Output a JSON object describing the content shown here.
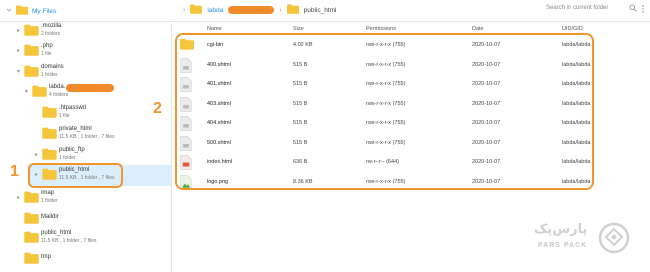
{
  "topbar": {
    "my_files": "My Files",
    "crumbs": [
      "labda",
      "public_html"
    ],
    "search_placeholder": "Search in current folder"
  },
  "sidebar": {
    "items": [
      {
        "name": ".mozilla",
        "meta": "2 folders"
      },
      {
        "name": ".php",
        "meta": "1 file"
      },
      {
        "name": "domains",
        "meta": "1 folder"
      },
      {
        "name": "labda.",
        "meta": "4 folders"
      },
      {
        "name": ".htpasswd",
        "meta": "1 file"
      },
      {
        "name": "private_html",
        "meta": "11.5 KB , 1 folder , 7 files"
      },
      {
        "name": "public_ftp",
        "meta": "1 folder"
      },
      {
        "name": "public_html",
        "meta": "11.5 KB , 1 folder , 7 files"
      },
      {
        "name": "imap",
        "meta": "1 folder"
      },
      {
        "name": "Maildir",
        "meta": ""
      },
      {
        "name": "public_html",
        "meta": "11.5 KB , 1 folder , 7 files"
      },
      {
        "name": "tmp",
        "meta": ""
      }
    ]
  },
  "table": {
    "headers": {
      "name": "Name",
      "size": "Size",
      "permissions": "Permissions",
      "date": "Date",
      "uid": "UID/GID"
    },
    "rows": [
      {
        "name": "cgi-bin",
        "size": "4.02 KB",
        "permissions": "rwx-r-x-r-x (755)",
        "date": "2020-10-07",
        "uid": "labda/labda",
        "icon": "folder-icon"
      },
      {
        "name": "400.shtml",
        "size": "515 B",
        "permissions": "rwx-r-x-r-x (755)",
        "date": "2020-10-07",
        "uid": "labda/labda",
        "icon": "file-icon"
      },
      {
        "name": "401.shtml",
        "size": "515 B",
        "permissions": "rwx-r-x-r-x (755)",
        "date": "2020-10-07",
        "uid": "labda/labda",
        "icon": "file-icon"
      },
      {
        "name": "403.shtml",
        "size": "515 B",
        "permissions": "rwx-r-x-r-x (755)",
        "date": "2020-10-07",
        "uid": "labda/labda",
        "icon": "file-icon"
      },
      {
        "name": "404.shtml",
        "size": "515 B",
        "permissions": "rwx-r-x-r-x (755)",
        "date": "2020-10-07",
        "uid": "labda/labda",
        "icon": "file-icon"
      },
      {
        "name": "500.shtml",
        "size": "515 B",
        "permissions": "rwx-r-x-r-x (755)",
        "date": "2020-10-07",
        "uid": "labda/labda",
        "icon": "file-icon"
      },
      {
        "name": "index.html",
        "size": "636 B",
        "permissions": "rw-r--r-- (644)",
        "date": "2020-10-07",
        "uid": "labda/labda",
        "icon": "html-file-icon"
      },
      {
        "name": "logo.png",
        "size": "8.36 KB",
        "permissions": "rwx-r-x-r-x (755)",
        "date": "2020-10-07",
        "uid": "labda/labda",
        "icon": "image-file-icon"
      }
    ]
  },
  "annotations": {
    "one": "1",
    "two": "2"
  },
  "logo": {
    "text": "پارس‌پک",
    "sub": "PARS PACK"
  },
  "colors": {
    "accent": "#2a8ee0",
    "annotation": "#f0962c",
    "folder": "#f5c53c",
    "selected": "#dbeefb"
  }
}
